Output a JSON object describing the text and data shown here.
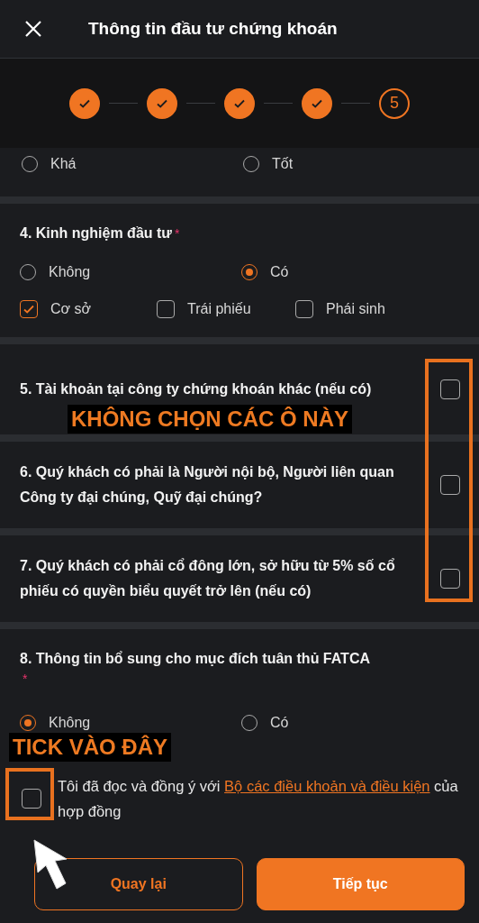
{
  "header": {
    "title": "Thông tin đầu tư chứng khoán"
  },
  "stepper": {
    "steps": [
      {
        "kind": "done"
      },
      {
        "kind": "done"
      },
      {
        "kind": "done"
      },
      {
        "kind": "done"
      },
      {
        "kind": "current",
        "label": "5"
      }
    ]
  },
  "questions": [
    {
      "kind": "options",
      "options": [
        {
          "label": "Khá",
          "selected": false
        },
        {
          "label": "Tốt",
          "selected": false
        }
      ]
    },
    {
      "kind": "options",
      "title": "4. Kinh nghiệm đầu tư",
      "required": true,
      "required_mark": "*",
      "options": [
        {
          "label": "Không",
          "selected": false
        },
        {
          "label": "Có",
          "selected": true
        }
      ],
      "checks": [
        {
          "label": "Cơ sở",
          "checked": true
        },
        {
          "label": "Trái phiếu",
          "checked": false
        },
        {
          "label": "Phái sinh",
          "checked": false
        }
      ]
    },
    {
      "kind": "toggle",
      "title": "5. Tài khoản tại công ty chứng khoán khác (nếu có)",
      "checked": false
    },
    {
      "kind": "toggle",
      "title": "6. Quý khách có phải là Người nội bộ, Người liên quan Công ty đại chúng, Quỹ đại chúng?",
      "checked": false
    },
    {
      "kind": "toggle",
      "title": "7. Quý khách có phải cổ đông lớn, sở hữu từ 5% số cổ phiếu có quyền biểu quyết trở lên (nếu có)",
      "checked": false
    },
    {
      "kind": "options",
      "title": "8. Thông tin bổ sung cho mục đích tuân thủ FATCA",
      "required": true,
      "required_mark": "*",
      "options": [
        {
          "label": "Không",
          "selected": true
        },
        {
          "label": "Có",
          "selected": false
        }
      ]
    }
  ],
  "agreement": {
    "checked": false,
    "text_before": "Tôi đã đọc và đồng ý với",
    "link": "Bộ các điều khoản và điều kiện",
    "text_after": "của hợp đồng"
  },
  "buttons": [
    {
      "label": "Quay lại",
      "kind": "secondary"
    },
    {
      "label": "Tiếp tục",
      "kind": "primary"
    }
  ],
  "annotations": [
    {
      "kind": "toggles",
      "text": "KHÔNG CHỌN CÁC Ô NÀY"
    },
    {
      "kind": "agreement",
      "text": "TICK VÀO ĐÂY"
    }
  ]
}
